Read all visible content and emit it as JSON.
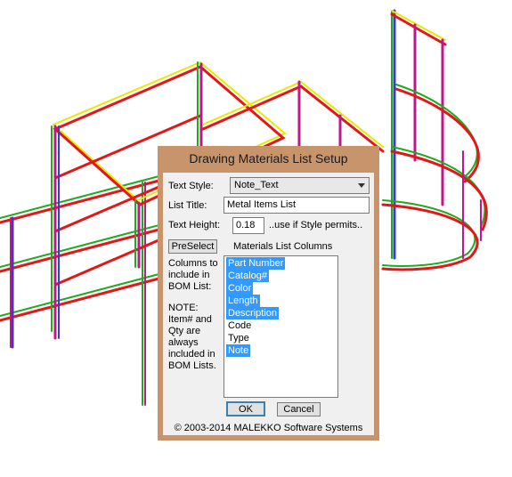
{
  "dialog": {
    "title": "Drawing Materials List Setup",
    "text_style_label": "Text Style:",
    "text_style_value": "Note_Text",
    "list_title_label": "List Title:",
    "list_title_value": "Metal Items List",
    "text_height_label": "Text Height:",
    "text_height_value": "0.18",
    "text_height_hint": "..use if Style permits..",
    "preselect_label": "PreSelect",
    "columns_header": "Materials List Columns",
    "columns_help": [
      "Columns to",
      "include in",
      "BOM List:"
    ],
    "note_text": [
      "NOTE:",
      "Item# and",
      "Qty are",
      "always",
      "included in",
      "BOM Lists."
    ],
    "columns": [
      {
        "label": "Part Number",
        "selected": true
      },
      {
        "label": "Catalog#",
        "selected": true
      },
      {
        "label": "Color",
        "selected": true
      },
      {
        "label": "Length",
        "selected": true
      },
      {
        "label": "Description",
        "selected": true
      },
      {
        "label": "Code",
        "selected": false
      },
      {
        "label": "Type",
        "selected": false
      },
      {
        "label": "Note",
        "selected": true
      }
    ],
    "ok_label": "OK",
    "cancel_label": "Cancel",
    "copyright": "© 2003-2014  MALEKKO Software Systems"
  },
  "colors": {
    "dialog_frame": "#c8946c",
    "selection": "#3399ff",
    "rail_red": "#e01818",
    "rail_green": "#1faa1f",
    "rail_yellow": "#e8e800",
    "post_magenta": "#c0168c",
    "post_blue": "#3a3acc"
  }
}
